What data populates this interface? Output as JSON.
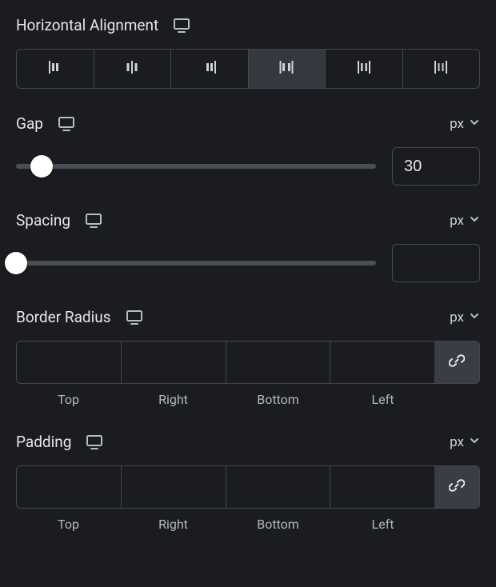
{
  "horizontal_alignment": {
    "label": "Horizontal Alignment",
    "responsive": true,
    "options": [
      {
        "name": "start"
      },
      {
        "name": "center"
      },
      {
        "name": "end"
      },
      {
        "name": "space-between",
        "active": true
      },
      {
        "name": "space-around"
      },
      {
        "name": "space-evenly"
      }
    ]
  },
  "gap": {
    "label": "Gap",
    "responsive": true,
    "unit": "px",
    "value": "30",
    "thumb_pct": 7
  },
  "spacing": {
    "label": "Spacing",
    "responsive": true,
    "unit": "px",
    "value": "",
    "thumb_pct": 0
  },
  "border_radius": {
    "label": "Border Radius",
    "responsive": true,
    "unit": "px",
    "sides": {
      "top": "",
      "right": "",
      "bottom": "",
      "left": ""
    },
    "side_labels": {
      "top": "Top",
      "right": "Right",
      "bottom": "Bottom",
      "left": "Left"
    },
    "linked": true
  },
  "padding": {
    "label": "Padding",
    "responsive": true,
    "unit": "px",
    "sides": {
      "top": "",
      "right": "",
      "bottom": "",
      "left": ""
    },
    "side_labels": {
      "top": "Top",
      "right": "Right",
      "bottom": "Bottom",
      "left": "Left"
    },
    "linked": true
  }
}
